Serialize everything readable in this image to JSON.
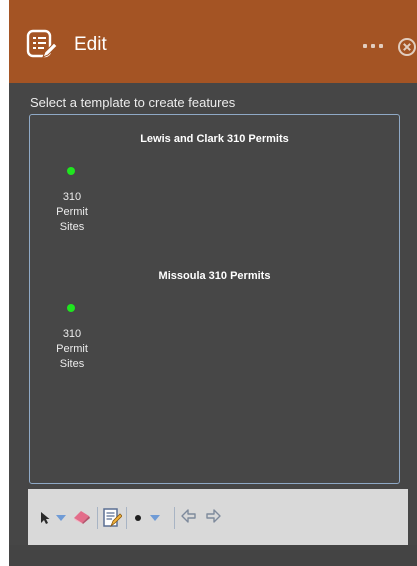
{
  "header": {
    "title": "Edit",
    "icon": "edit-widget-icon",
    "menu_icon": "more-options-icon",
    "close_icon": "close-icon",
    "color": "#a45424"
  },
  "instruction": "Select a template to create features",
  "groups": [
    {
      "title": "Lewis and Clark 310 Permits",
      "templates": [
        {
          "label": "310\nPermit\nSites",
          "color": "#1fe51f"
        }
      ]
    },
    {
      "title": "Missoula 310 Permits",
      "templates": [
        {
          "label": "310\nPermit\nSites",
          "color": "#1fe51f"
        }
      ]
    }
  ],
  "toolbar": {
    "tools": [
      "select-arrow-icon",
      "dropdown-arrow-icon",
      "eraser-icon",
      "attributes-icon",
      "point-icon",
      "dropdown-arrow-icon",
      "undo-icon",
      "redo-icon"
    ]
  }
}
